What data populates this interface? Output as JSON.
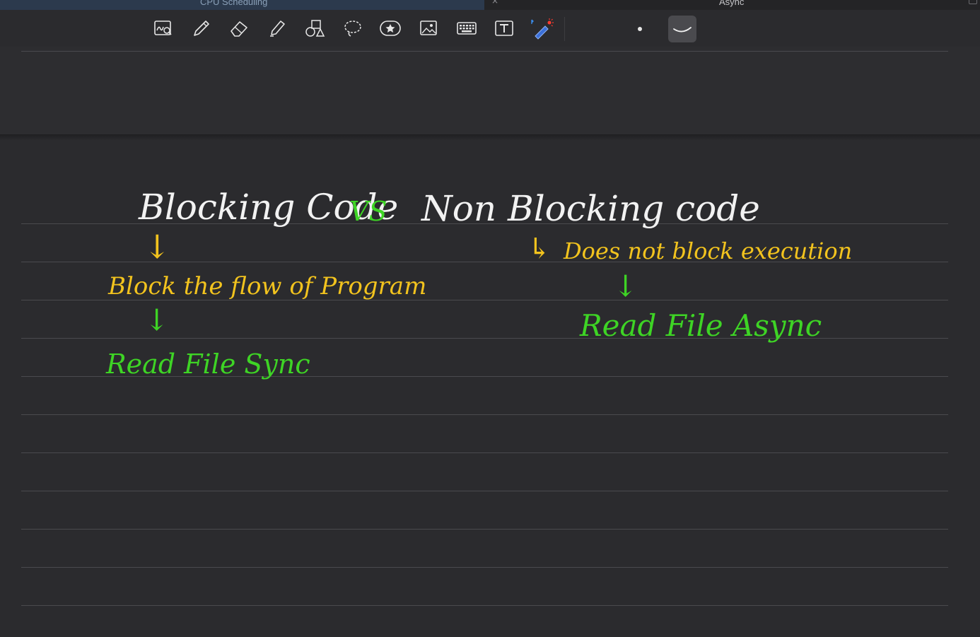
{
  "tabs": [
    {
      "label": "CPU Scheduling"
    },
    {
      "label": "Async"
    }
  ],
  "tab_close_glyph": "×",
  "toolbar": {
    "tools": [
      {
        "name": "zoom-handwriting-icon"
      },
      {
        "name": "pen-icon"
      },
      {
        "name": "eraser-icon"
      },
      {
        "name": "highlighter-icon"
      },
      {
        "name": "shapes-icon"
      },
      {
        "name": "lasso-icon"
      },
      {
        "name": "sticker-icon"
      },
      {
        "name": "image-icon"
      },
      {
        "name": "keyboard-icon"
      },
      {
        "name": "text-box-icon"
      },
      {
        "name": "laser-pointer-icon"
      }
    ]
  },
  "notes": {
    "title_left": "Blocking Code",
    "title_vs": "VS",
    "title_right": "Non Blocking code",
    "arrow_down": "↓",
    "arrow_right_hook": "↳",
    "left_desc": "Block the flow of Program",
    "left_example": "Read File Sync",
    "right_desc": "Does not block execution",
    "right_example": "Read File Async"
  },
  "colors": {
    "white_ink": "#f2f2f2",
    "yellow_ink": "#f2c31e",
    "green_ink": "#3ed425",
    "background": "#2b2b2e"
  }
}
